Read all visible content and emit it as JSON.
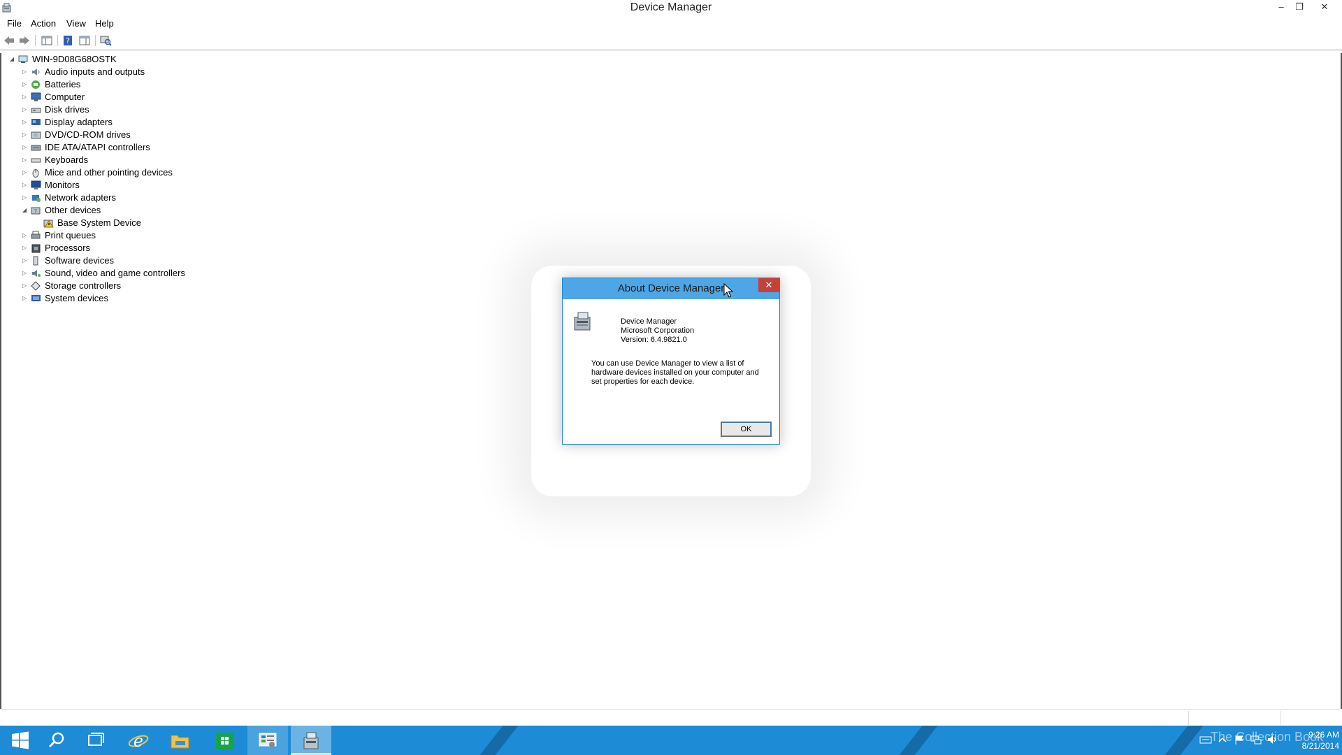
{
  "window": {
    "title": "Device Manager"
  },
  "menu": [
    "File",
    "Action",
    "View",
    "Help"
  ],
  "tree": {
    "root": "WIN-9D08G68OSTK",
    "categories": [
      {
        "label": "Audio inputs and outputs",
        "icon": "speaker-icon",
        "expanded": false
      },
      {
        "label": "Batteries",
        "icon": "battery-icon",
        "expanded": false
      },
      {
        "label": "Computer",
        "icon": "computer-icon",
        "expanded": false
      },
      {
        "label": "Disk drives",
        "icon": "disk-drive-icon",
        "expanded": false
      },
      {
        "label": "Display adapters",
        "icon": "display-adapter-icon",
        "expanded": false
      },
      {
        "label": "DVD/CD-ROM drives",
        "icon": "dvd-drive-icon",
        "expanded": false
      },
      {
        "label": "IDE ATA/ATAPI controllers",
        "icon": "ide-controller-icon",
        "expanded": false
      },
      {
        "label": "Keyboards",
        "icon": "keyboard-icon",
        "expanded": false
      },
      {
        "label": "Mice and other pointing devices",
        "icon": "mouse-icon",
        "expanded": false
      },
      {
        "label": "Monitors",
        "icon": "monitor-icon",
        "expanded": false
      },
      {
        "label": "Network adapters",
        "icon": "network-adapter-icon",
        "expanded": false
      },
      {
        "label": "Other devices",
        "icon": "other-devices-icon",
        "expanded": true,
        "children": [
          {
            "label": "Base System Device",
            "icon": "warning-device-icon"
          }
        ]
      },
      {
        "label": "Print queues",
        "icon": "printer-icon",
        "expanded": false
      },
      {
        "label": "Processors",
        "icon": "processor-icon",
        "expanded": false
      },
      {
        "label": "Software devices",
        "icon": "software-device-icon",
        "expanded": false
      },
      {
        "label": "Sound, video and game controllers",
        "icon": "sound-controller-icon",
        "expanded": false
      },
      {
        "label": "Storage controllers",
        "icon": "storage-controller-icon",
        "expanded": false
      },
      {
        "label": "System devices",
        "icon": "system-devices-icon",
        "expanded": false
      }
    ]
  },
  "dialog": {
    "title": "About Device Manager",
    "product": "Device Manager",
    "company": "Microsoft Corporation",
    "version": "Version: 6.4.9821.0",
    "description": "You can use Device Manager to view a list of hardware devices installed on your computer and set properties for each device.",
    "ok_label": "OK"
  },
  "taskbar": {
    "time": "9:26 AM",
    "date": "8/21/2014",
    "watermark": "The Collection Book"
  },
  "colors": {
    "taskbar": "#1d8bd6",
    "dialog_title": "#4ea6e6",
    "close_button": "#c7413a"
  }
}
